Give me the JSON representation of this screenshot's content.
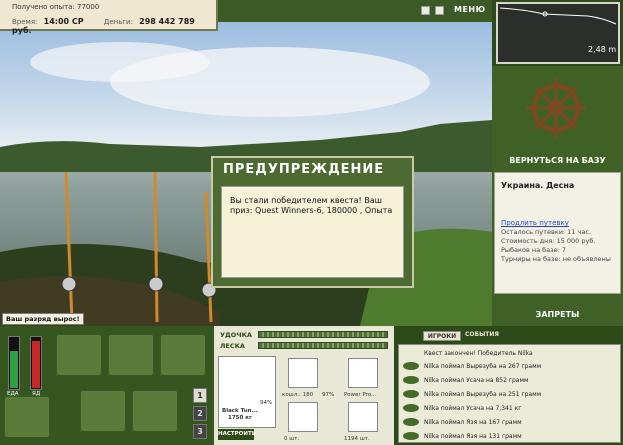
{
  "header": {
    "experience": "Получено опыта: 77000",
    "time_label": "Время:",
    "time_value": "14:00 CP",
    "money_label": "Деньги:",
    "money_value": "298 442 789 руб.",
    "menu_label": "МЕНЮ"
  },
  "map": {
    "depth": "2,48 m"
  },
  "right_panel": {
    "back_to_base": "ВЕРНУТЬСЯ НА БАЗУ",
    "location": "Украина. Десна",
    "extend_link": "Продлить путевку",
    "trip_left": "Осталось путевки: 11 час.",
    "day_cost": "Стоимость дня: 15 000 руб.",
    "fishers": "Рыбаков на базе: 7",
    "tournaments": "Турниры на базе: не объявлены",
    "bans": "ЗАПРЕТЫ"
  },
  "dialog": {
    "title": "ПРЕДУПРЕЖДЕНИЕ",
    "message": "Вы стали победителем квеста! Ваш приз: Quest Winners-6, 180000 , Опыта"
  },
  "rank_badge": "Ваш разряд вырос!",
  "meters": {
    "food": "ЕДА",
    "health": "ЯД",
    "food_level": 0.72,
    "health_level": 0.9
  },
  "inventory": {
    "pages": [
      "1",
      "2",
      "3"
    ]
  },
  "rod_panel": {
    "rod_label": "УДОЧКА",
    "line_label": "ЛЕСКА",
    "rod_name": "Black Tun...",
    "rod_weight": "1750 кг",
    "rod_percent": "94%",
    "reel_caption": "кошл.: 180",
    "reel_percent": "97%",
    "bait_caption": "Power Pro...",
    "hook_caption": "0 шт.",
    "lure_caption": "1194 шт.",
    "setup_button": "НАСТРОИТЬ"
  },
  "chat": {
    "tab_players": "ИГРОКИ",
    "tab_events": "СОБЫТИЯ",
    "quest_line": "Квест закончен! Победитель Nilka",
    "events": [
      "Nilka поймал Вырезуба на 267 грамм",
      "Nilka поймал Усача на 852 грамм",
      "Nilka поймал Вырезуба на 251 грамм",
      "Nilka поймал Усача на 7,341 кг",
      "Nilka поймал Язя на 167 грамм",
      "Nilka поймал Язя на 131 грамм"
    ]
  },
  "colors": {
    "accent": "#3f6125",
    "panel": "#f3f1e6"
  }
}
